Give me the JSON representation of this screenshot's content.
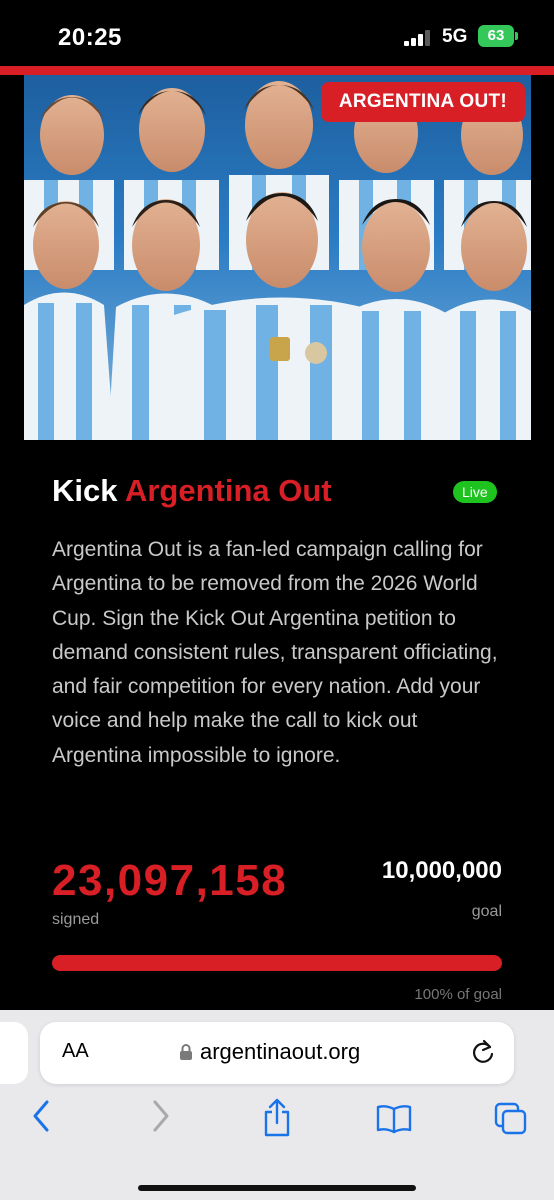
{
  "status_bar": {
    "time": "20:25",
    "network": "5G",
    "battery": "63"
  },
  "hero": {
    "badge": "ARGENTINA OUT!"
  },
  "campaign": {
    "title_part1": "Kick",
    "title_part2": "Argentina Out",
    "live_badge": "Live",
    "description": "Argentina Out is a fan-led campaign calling for Argentina to be removed from the 2026 World Cup. Sign the Kick Out Argentina petition to demand consistent rules, transparent officiating, and fair competition for every nation. Add your voice and help make the call to kick out Argentina impossible to ignore.",
    "signed_count": "23,097,158",
    "signed_label": "signed",
    "goal_value": "10,000,000",
    "goal_label": "goal",
    "progress_percent": 100,
    "progress_text": "100% of goal"
  },
  "browser": {
    "aa_label": "AA",
    "url": "argentinaout.org",
    "icons": [
      "lock-icon",
      "reload-icon",
      "back-icon",
      "forward-icon",
      "share-icon",
      "bookmarks-icon",
      "tabs-icon"
    ]
  },
  "colors": {
    "accent": "#d91f26",
    "live": "#1fc31f",
    "battery": "#34c759",
    "jersey_blue": "#6fb2e3"
  }
}
